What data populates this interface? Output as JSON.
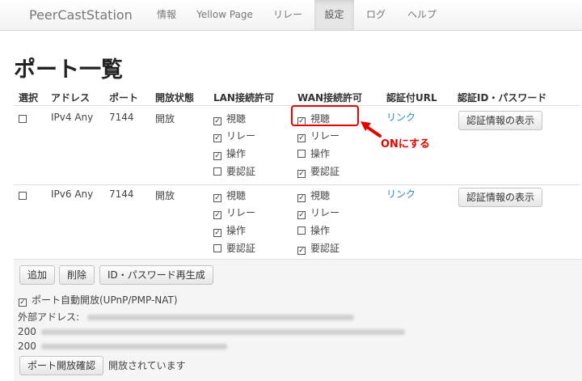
{
  "nav": {
    "brand": "PeerCastStation",
    "items": [
      "情報",
      "Yellow Page",
      "リレー",
      "設定",
      "ログ",
      "ヘルプ"
    ],
    "active": "設定"
  },
  "page_title": "ポート一覧",
  "table": {
    "headers": [
      "選択",
      "アドレス",
      "ポート",
      "開放状態",
      "LAN接続許可",
      "WAN接続許可",
      "認証付URL",
      "認証ID・パスワード"
    ],
    "rows": [
      {
        "address": "IPv4 Any",
        "port": "7144",
        "status": "開放",
        "lan": [
          "視聴",
          "リレー",
          "操作",
          "要認証"
        ],
        "wan": [
          "視聴",
          "リレー",
          "操作",
          "要認証"
        ],
        "auth_url": "リンク",
        "auth_button": "認証情報の表示"
      },
      {
        "address": "IPv6 Any",
        "port": "7144",
        "status": "開放",
        "lan": [
          "視聴",
          "リレー",
          "操作",
          "要認証"
        ],
        "wan": [
          "視聴",
          "リレー",
          "操作",
          "要認証"
        ],
        "auth_url": "リンク",
        "auth_button": "認証情報の表示"
      }
    ]
  },
  "annotation": {
    "text": "ONにする",
    "color": "#e60000"
  },
  "panel": {
    "buttons": {
      "add": "追加",
      "delete": "削除",
      "regenerate": "ID・パスワード再生成"
    },
    "auto_open_label": "ポート自動開放(UPnP/PMP-NAT)",
    "external_address_label": "外部アドレス:",
    "external_address_line_prefix": "200",
    "check_button": "ポート開放確認",
    "check_status": "開放されています"
  }
}
